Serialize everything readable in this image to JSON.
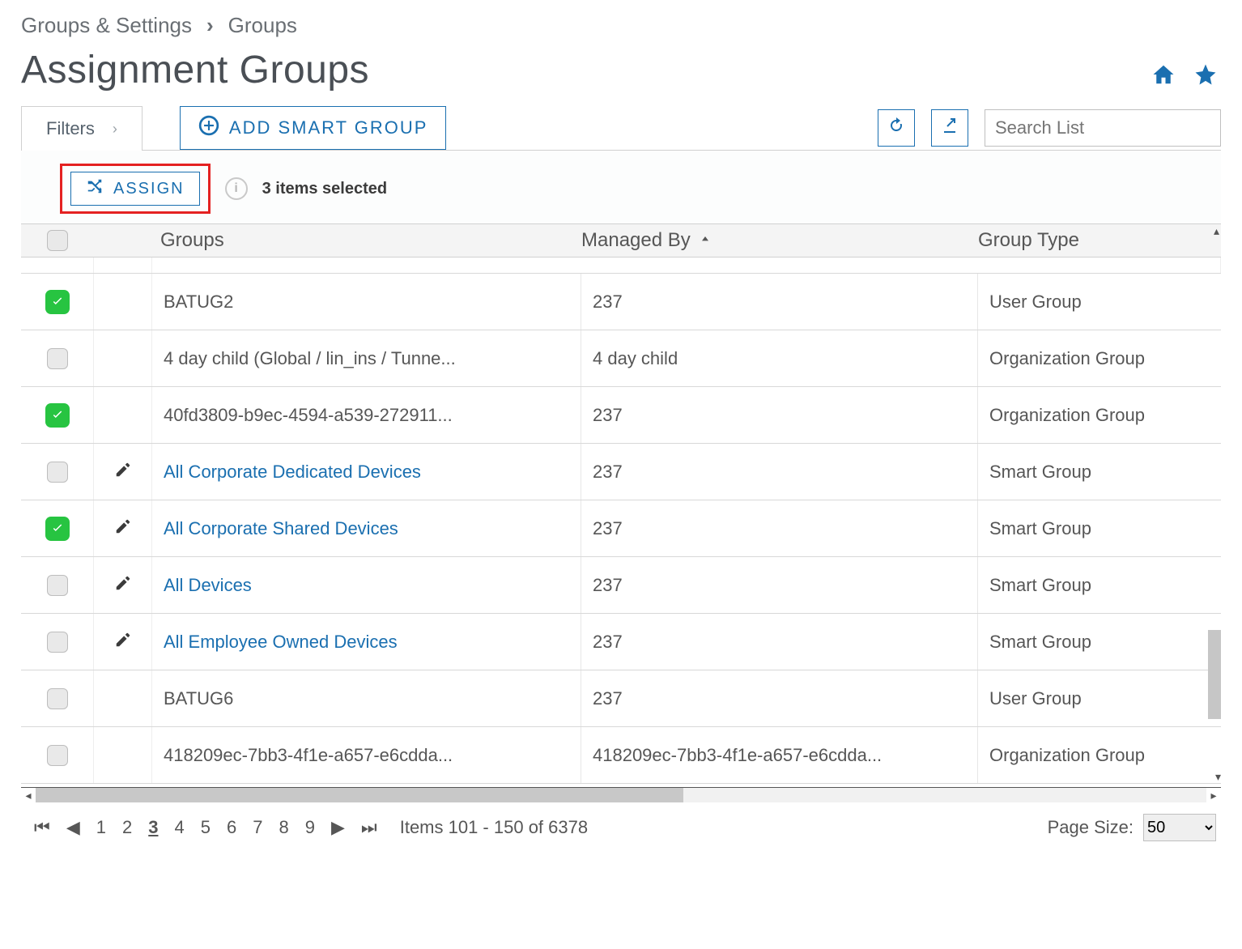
{
  "breadcrumb": {
    "a": "Groups & Settings",
    "b": "Groups"
  },
  "page_title": "Assignment Groups",
  "toolbar": {
    "filters_label": "Filters",
    "add_smart_group_label": "ADD SMART GROUP",
    "search_placeholder": "Search List"
  },
  "selection": {
    "assign_label": "ASSIGN",
    "summary": "3 items selected"
  },
  "columns": {
    "groups": "Groups",
    "managed_by": "Managed By",
    "group_type": "Group Type"
  },
  "rows": [
    {
      "checked": true,
      "editable": false,
      "group": "BATUG2",
      "link": false,
      "managed": "237",
      "type": "User Group"
    },
    {
      "checked": false,
      "editable": false,
      "group": "4 day child (Global / lin_ins / Tunne...",
      "link": false,
      "managed": "4 day child",
      "type": "Organization Group"
    },
    {
      "checked": true,
      "editable": false,
      "group": "40fd3809-b9ec-4594-a539-272911...",
      "link": false,
      "managed": "237",
      "type": "Organization Group"
    },
    {
      "checked": false,
      "editable": true,
      "group": "All Corporate Dedicated Devices",
      "link": true,
      "managed": "237",
      "type": "Smart Group"
    },
    {
      "checked": true,
      "editable": true,
      "group": "All Corporate Shared Devices",
      "link": true,
      "managed": "237",
      "type": "Smart Group"
    },
    {
      "checked": false,
      "editable": true,
      "group": "All Devices",
      "link": true,
      "managed": "237",
      "type": "Smart Group"
    },
    {
      "checked": false,
      "editable": true,
      "group": "All Employee Owned Devices",
      "link": true,
      "managed": "237",
      "type": "Smart Group"
    },
    {
      "checked": false,
      "editable": false,
      "group": "BATUG6",
      "link": false,
      "managed": "237",
      "type": "User Group"
    },
    {
      "checked": false,
      "editable": false,
      "group": "418209ec-7bb3-4f1e-a657-e6cdda...",
      "link": false,
      "managed": "418209ec-7bb3-4f1e-a657-e6cdda...",
      "type": "Organization Group"
    }
  ],
  "pager": {
    "pages": [
      "1",
      "2",
      "3",
      "4",
      "5",
      "6",
      "7",
      "8",
      "9"
    ],
    "current": "3",
    "summary": "Items 101 - 150 of 6378",
    "page_size_label": "Page Size:",
    "page_size_value": "50"
  }
}
